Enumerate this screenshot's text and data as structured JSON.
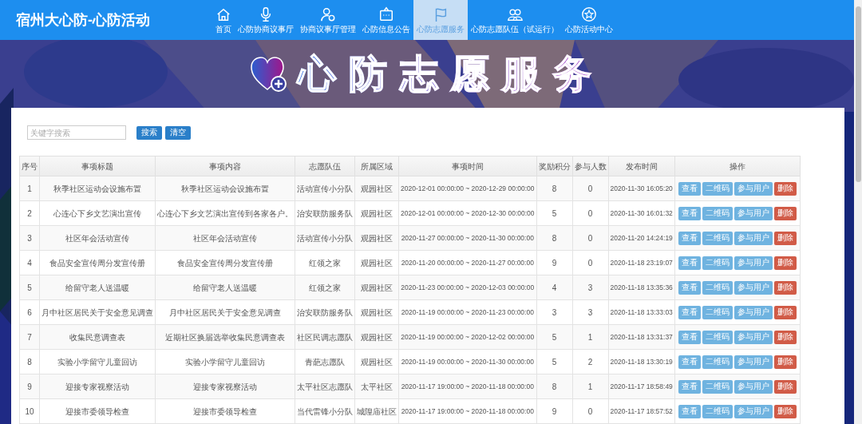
{
  "header": {
    "title": "宿州大心防-心防活动"
  },
  "nav": [
    {
      "label": "首页",
      "selected": false
    },
    {
      "label": "心防协商议事厅",
      "selected": false
    },
    {
      "label": "协商议事厅管理",
      "selected": false
    },
    {
      "label": "心防信息公告",
      "selected": false
    },
    {
      "label": "心防志愿服务",
      "selected": true
    },
    {
      "label": "心防志愿队伍（试运行）",
      "selected": false
    },
    {
      "label": "心防活动中心",
      "selected": false
    }
  ],
  "banner": {
    "headline": "心防志愿服务"
  },
  "search": {
    "placeholder": "关键字搜索",
    "buttons": [
      "搜索",
      "清空"
    ]
  },
  "table": {
    "columns": [
      "序号",
      "事项标题",
      "事项内容",
      "志愿队伍",
      "所属区域",
      "事项时间",
      "奖励积分",
      "参与人数",
      "发布时间",
      "操作"
    ],
    "rows": [
      {
        "cells": [
          "1",
          "秋季社区运动会设施布置",
          "秋季社区运动会设施布置",
          "活动宣传小分队",
          "观园社区",
          "2020-12-01 00:00:00 ~ 2020-12-29 00:00:00",
          "8",
          "0",
          "2020-11-30 16:05:20"
        ],
        "actions": [
          {
            "label": "查看",
            "kind": "info"
          },
          {
            "label": "二维码",
            "kind": "info"
          },
          {
            "label": "参与用户",
            "kind": "info"
          },
          {
            "label": "删除",
            "kind": "danger"
          }
        ]
      },
      {
        "cells": [
          "2",
          "心连心下乡文艺演出宣传",
          "心连心下乡文艺演出宣传到各家各户。",
          "治安联防服务队",
          "观园社区",
          "2020-12-01 00:00:00 ~ 2020-12-30 00:00:00",
          "5",
          "0",
          "2020-11-30 16:01:32"
        ],
        "actions": [
          {
            "label": "查看",
            "kind": "info"
          },
          {
            "label": "二维码",
            "kind": "info"
          },
          {
            "label": "参与用户",
            "kind": "info"
          },
          {
            "label": "删除",
            "kind": "danger"
          }
        ]
      },
      {
        "cells": [
          "3",
          "社区年会活动宣传",
          "社区年会活动宣传",
          "活动宣传小分队",
          "观园社区",
          "2020-11-27 00:00:00 ~ 2020-11-30 00:00:00",
          "8",
          "0",
          "2020-11-20 14:24:19"
        ],
        "actions": [
          {
            "label": "查看",
            "kind": "info"
          },
          {
            "label": "二维码",
            "kind": "info"
          },
          {
            "label": "参与用户",
            "kind": "info"
          },
          {
            "label": "删除",
            "kind": "danger"
          }
        ]
      },
      {
        "cells": [
          "4",
          "食品安全宣传周分发宣传册",
          "食品安全宣传周分发宣传册",
          "红领之家",
          "观园社区",
          "2020-11-20 00:00:00 ~ 2020-11-27 00:00:00",
          "9",
          "0",
          "2020-11-18 23:19:07"
        ],
        "actions": [
          {
            "label": "查看",
            "kind": "info"
          },
          {
            "label": "二维码",
            "kind": "info"
          },
          {
            "label": "参与用户",
            "kind": "info"
          },
          {
            "label": "删除",
            "kind": "danger"
          }
        ]
      },
      {
        "cells": [
          "5",
          "给留守老人送温暖",
          "给留守老人送温暖",
          "红领之家",
          "观园社区",
          "2020-11-23 00:00:00 ~ 2020-12-03 00:00:00",
          "4",
          "3",
          "2020-11-18 13:35:36"
        ],
        "actions": [
          {
            "label": "查看",
            "kind": "info"
          },
          {
            "label": "二维码",
            "kind": "info"
          },
          {
            "label": "参与用户",
            "kind": "info"
          },
          {
            "label": "删除",
            "kind": "danger"
          }
        ]
      },
      {
        "cells": [
          "6",
          "月中社区居民关于安全意见调查",
          "月中社区居民关于安全意见调查",
          "治安联防服务队",
          "观园社区",
          "2020-11-19 00:00:00 ~ 2020-11-23 00:00:00",
          "3",
          "3",
          "2020-11-18 13:33:03"
        ],
        "actions": [
          {
            "label": "查看",
            "kind": "info"
          },
          {
            "label": "二维码",
            "kind": "info"
          },
          {
            "label": "参与用户",
            "kind": "info"
          },
          {
            "label": "删除",
            "kind": "danger"
          }
        ]
      },
      {
        "cells": [
          "7",
          "收集民意调查表",
          "近期社区换届选举收集民意调查表",
          "社区民调志愿队",
          "观园社区",
          "2020-11-19 00:00:00 ~ 2020-12-02 00:00:00",
          "5",
          "1",
          "2020-11-18 13:31:37"
        ],
        "actions": [
          {
            "label": "查看",
            "kind": "info"
          },
          {
            "label": "二维码",
            "kind": "info"
          },
          {
            "label": "参与用户",
            "kind": "info"
          },
          {
            "label": "删除",
            "kind": "danger"
          }
        ]
      },
      {
        "cells": [
          "8",
          "实验小学留守儿童回访",
          "实验小学留守儿童回访",
          "青葩志愿队",
          "观园社区",
          "2020-11-19 00:00:00 ~ 2020-11-30 00:00:00",
          "5",
          "2",
          "2020-11-18 13:30:19"
        ],
        "actions": [
          {
            "label": "查看",
            "kind": "info"
          },
          {
            "label": "二维码",
            "kind": "info"
          },
          {
            "label": "参与用户",
            "kind": "info"
          },
          {
            "label": "删除",
            "kind": "danger"
          }
        ]
      },
      {
        "cells": [
          "9",
          "迎接专家视察活动",
          "迎接专家视察活动",
          "太平社区志愿队",
          "太平社区",
          "2020-11-17 19:00:00 ~ 2020-11-18 00:00:00",
          "8",
          "1",
          "2020-11-17 18:58:49"
        ],
        "actions": [
          {
            "label": "查看",
            "kind": "info"
          },
          {
            "label": "二维码",
            "kind": "info"
          },
          {
            "label": "参与用户",
            "kind": "info"
          },
          {
            "label": "删除",
            "kind": "danger"
          }
        ]
      },
      {
        "cells": [
          "10",
          "迎接市委领导检查",
          "迎接市委领导检查",
          "当代雷锋小分队",
          "城隍庙社区",
          "2020-11-17 19:00:00 ~ 2020-11-18 00:00:00",
          "9",
          "0",
          "2020-11-17 18:57:52"
        ],
        "actions": [
          {
            "label": "查看",
            "kind": "info"
          },
          {
            "label": "二维码",
            "kind": "info"
          },
          {
            "label": "参与用户",
            "kind": "info"
          },
          {
            "label": "删除",
            "kind": "danger"
          }
        ]
      }
    ]
  }
}
